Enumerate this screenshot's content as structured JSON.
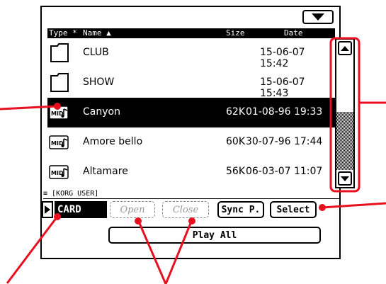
{
  "header": {
    "type": "Type *",
    "name": "Name ▲",
    "size": "Size",
    "date": "Date"
  },
  "rows": [
    {
      "icon": "folder-icon",
      "name": "CLUB",
      "size": "",
      "date": "15-06-07 15:42"
    },
    {
      "icon": "folder-icon",
      "name": "SHOW",
      "size": "",
      "date": "15-06-07 15:43"
    },
    {
      "icon": "midi-file-icon",
      "name": "Canyon",
      "size": "62K",
      "date": "01-08-96 19:33"
    },
    {
      "icon": "midi-file-icon",
      "name": "Amore bello",
      "size": "60K",
      "date": "30-07-96 17:44"
    },
    {
      "icon": "midi-file-icon",
      "name": "Altamare",
      "size": "56K",
      "date": "06-03-07 11:07"
    }
  ],
  "path": "≡ [KORG USER]",
  "device": "CARD",
  "buttons": {
    "open": "Open",
    "close": "Close",
    "sync": "Sync P.",
    "select": "Select",
    "play_all": "Play All"
  },
  "icons": {
    "midi_label": "MID"
  },
  "colors": {
    "annotation": "#e8101e"
  }
}
